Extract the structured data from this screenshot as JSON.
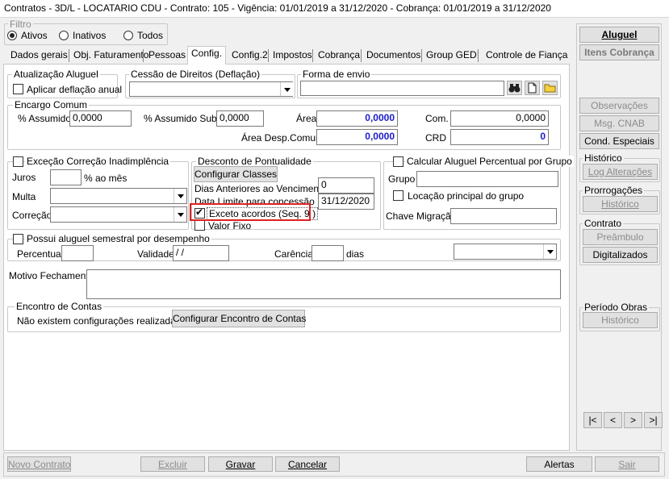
{
  "window": {
    "title": "Contratos - 3D/L - LOCATARIO CDU - Contrato: 105 - Vigência: 01/01/2019 a 31/12/2020 - Cobrança: 01/01/2019 a 31/12/2020"
  },
  "filter": {
    "legend": "Filtro",
    "options": [
      "Ativos",
      "Inativos",
      "Todos"
    ],
    "selected": "Ativos"
  },
  "tabs": [
    "Dados gerais",
    "Obj. Faturamento",
    "Pessoas",
    "Config.",
    "Config.2",
    "Impostos",
    "Cobrança",
    "Documentos",
    "Group GED!",
    "Controle de Fiança"
  ],
  "active_tab": "Config.",
  "atualizacao": {
    "legend": "Atualização Aluguel",
    "aplicar_label": "Aplicar deflação anual"
  },
  "cessao": {
    "legend": "Cessão de Direitos (Deflação)",
    "value": ""
  },
  "forma_envio": {
    "legend": "Forma de envio",
    "value": ""
  },
  "encargo": {
    "legend": "Encargo Comum",
    "assumido_label": "% Assumido",
    "assumido_value": "0,0000",
    "assumido_sub_label": "% Assumido Sub",
    "assumido_sub_value": "0,0000",
    "area_label": "Área",
    "area_value": "0,0000",
    "area_desp_label": "Área Desp.Comum",
    "area_desp_value": "0,0000",
    "com_label": "Com.",
    "com_value": "0,0000",
    "crd_label": "CRD",
    "crd_value": "0"
  },
  "excecao": {
    "legend": "Exceção Correção Inadimplência",
    "juros_label": "Juros",
    "juros_value": "",
    "ao_mes_label": "% ao mês",
    "multa_label": "Multa",
    "correcao_label": "Correção"
  },
  "desconto": {
    "legend": "Desconto de Pontualidade",
    "configurar_label": "Configurar Classes",
    "dias_label": "Dias Anteriores ao Vencimento",
    "dias_value": "0",
    "data_label": "Data Limite para concessão",
    "data_value": "31/12/2020",
    "exceto_label": "Exceto acordos (Seq. 9 )",
    "exceto_checked": true,
    "valor_fixo_label": "Valor Fixo",
    "valor_fixo_checked": false
  },
  "percentual_grupo": {
    "legend": "Calcular Aluguel Percentual por Grupo",
    "grupo_label": "Grupo",
    "grupo_value": "",
    "locacao_label": "Locação principal do grupo",
    "chave_label": "Chave Migração",
    "chave_value": ""
  },
  "semestral": {
    "legend": "Possui aluguel semestral por desempenho",
    "percentual_label": "Percentual",
    "percentual_value": "",
    "validade_label": "Validade",
    "validade_value": " / /",
    "carencia_label": "Carência",
    "carencia_value": "",
    "dias_label": "dias"
  },
  "motivo": {
    "label": "Motivo Fechamento",
    "value": ""
  },
  "encontro": {
    "legend": "Encontro de Contas",
    "message": "Não existem configurações realizadas.",
    "button": "Configurar Encontro de Contas"
  },
  "sidebar": {
    "aluguel": "Aluguel",
    "itens_cobranca": "Itens Cobrança",
    "observacoes": "Observações",
    "msg_cnab": "Msg. CNAB",
    "cond_especiais": "Cond. Especiais",
    "historico_legend": "Histórico",
    "log_alteracoes": "Log Alterações",
    "prorrogacoes_legend": "Prorrogações",
    "prorrogacoes_historico": "Histórico",
    "contrato_legend": "Contrato",
    "preambulo": "Preâmbulo",
    "digitalizados": "Digitalizados",
    "periodo_legend": "Período Obras",
    "periodo_historico": "Histórico",
    "nav": [
      "|<",
      "<",
      ">",
      ">|"
    ]
  },
  "footer": {
    "novo_contrato": "Novo Contrato",
    "excluir": "Excluir",
    "gravar": "Gravar",
    "cancelar": "Cancelar",
    "alertas": "Alertas",
    "sair": "Sair"
  },
  "colors": {
    "highlight": "#e02020",
    "value_blue": "#1a1acc"
  }
}
